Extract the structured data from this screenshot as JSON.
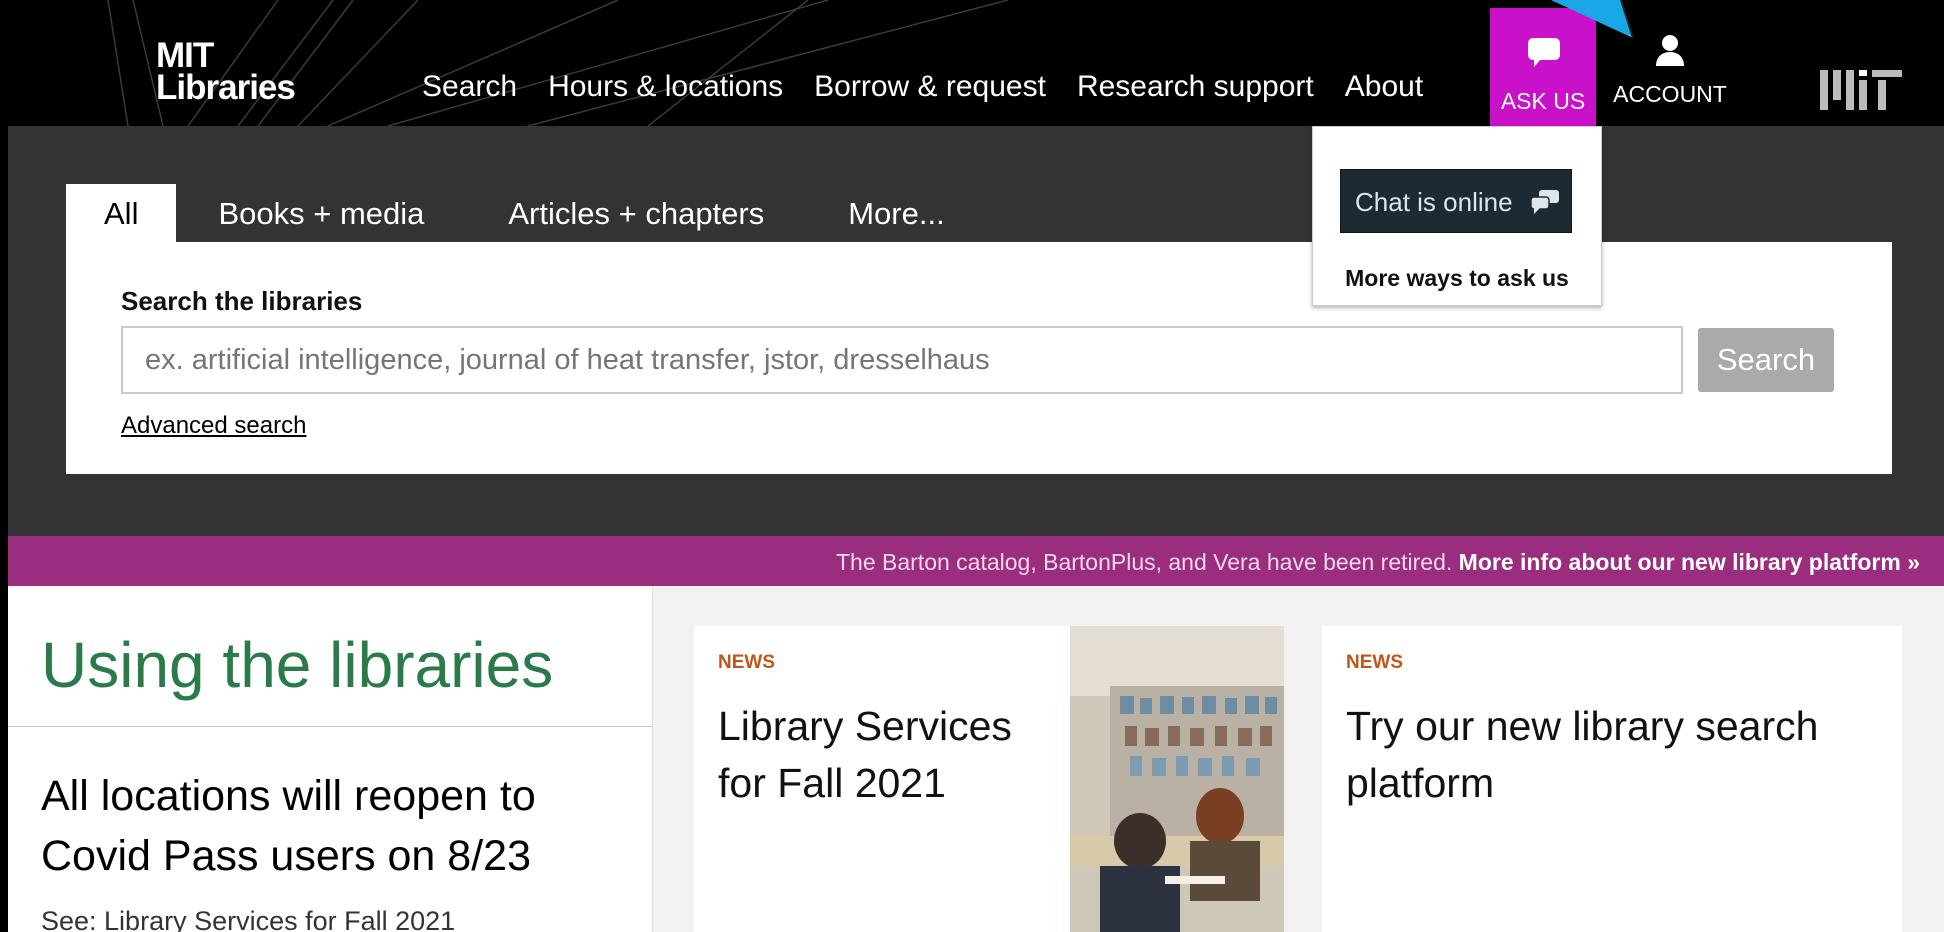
{
  "logo": {
    "line1": "MIT",
    "line2": "Libraries"
  },
  "nav": {
    "items": [
      "Search",
      "Hours & locations",
      "Borrow & request",
      "Research support",
      "About"
    ],
    "ask_us": "ASK US",
    "account": "ACCOUNT"
  },
  "search": {
    "tabs": [
      "All",
      "Books + media",
      "Articles + chapters",
      "More..."
    ],
    "label": "Search the libraries",
    "placeholder": "ex. artificial intelligence, journal of heat transfer, jstor, dresselhaus",
    "button": "Search",
    "advanced": "Advanced search"
  },
  "ask_dropdown": {
    "chat": "Chat is online",
    "more": "More ways to ask us"
  },
  "alert": {
    "text": "The Barton catalog, BartonPlus, and Vera have been retired.",
    "link": "More info about our new library platform »"
  },
  "main": {
    "heading": "Using the libraries",
    "notice": "All locations will reopen to Covid Pass users on 8/23",
    "see": "See: Library Services for Fall 2021",
    "cards": [
      {
        "tag": "NEWS",
        "title": "Library Services for Fall 2021"
      },
      {
        "tag": "NEWS",
        "title": "Try our new library search platform"
      }
    ]
  },
  "colors": {
    "ask_us_bg": "#c811c8",
    "alert_bg": "#9b2d7e",
    "heading_green": "#2a7a4a",
    "news_orange": "#c0561a"
  }
}
